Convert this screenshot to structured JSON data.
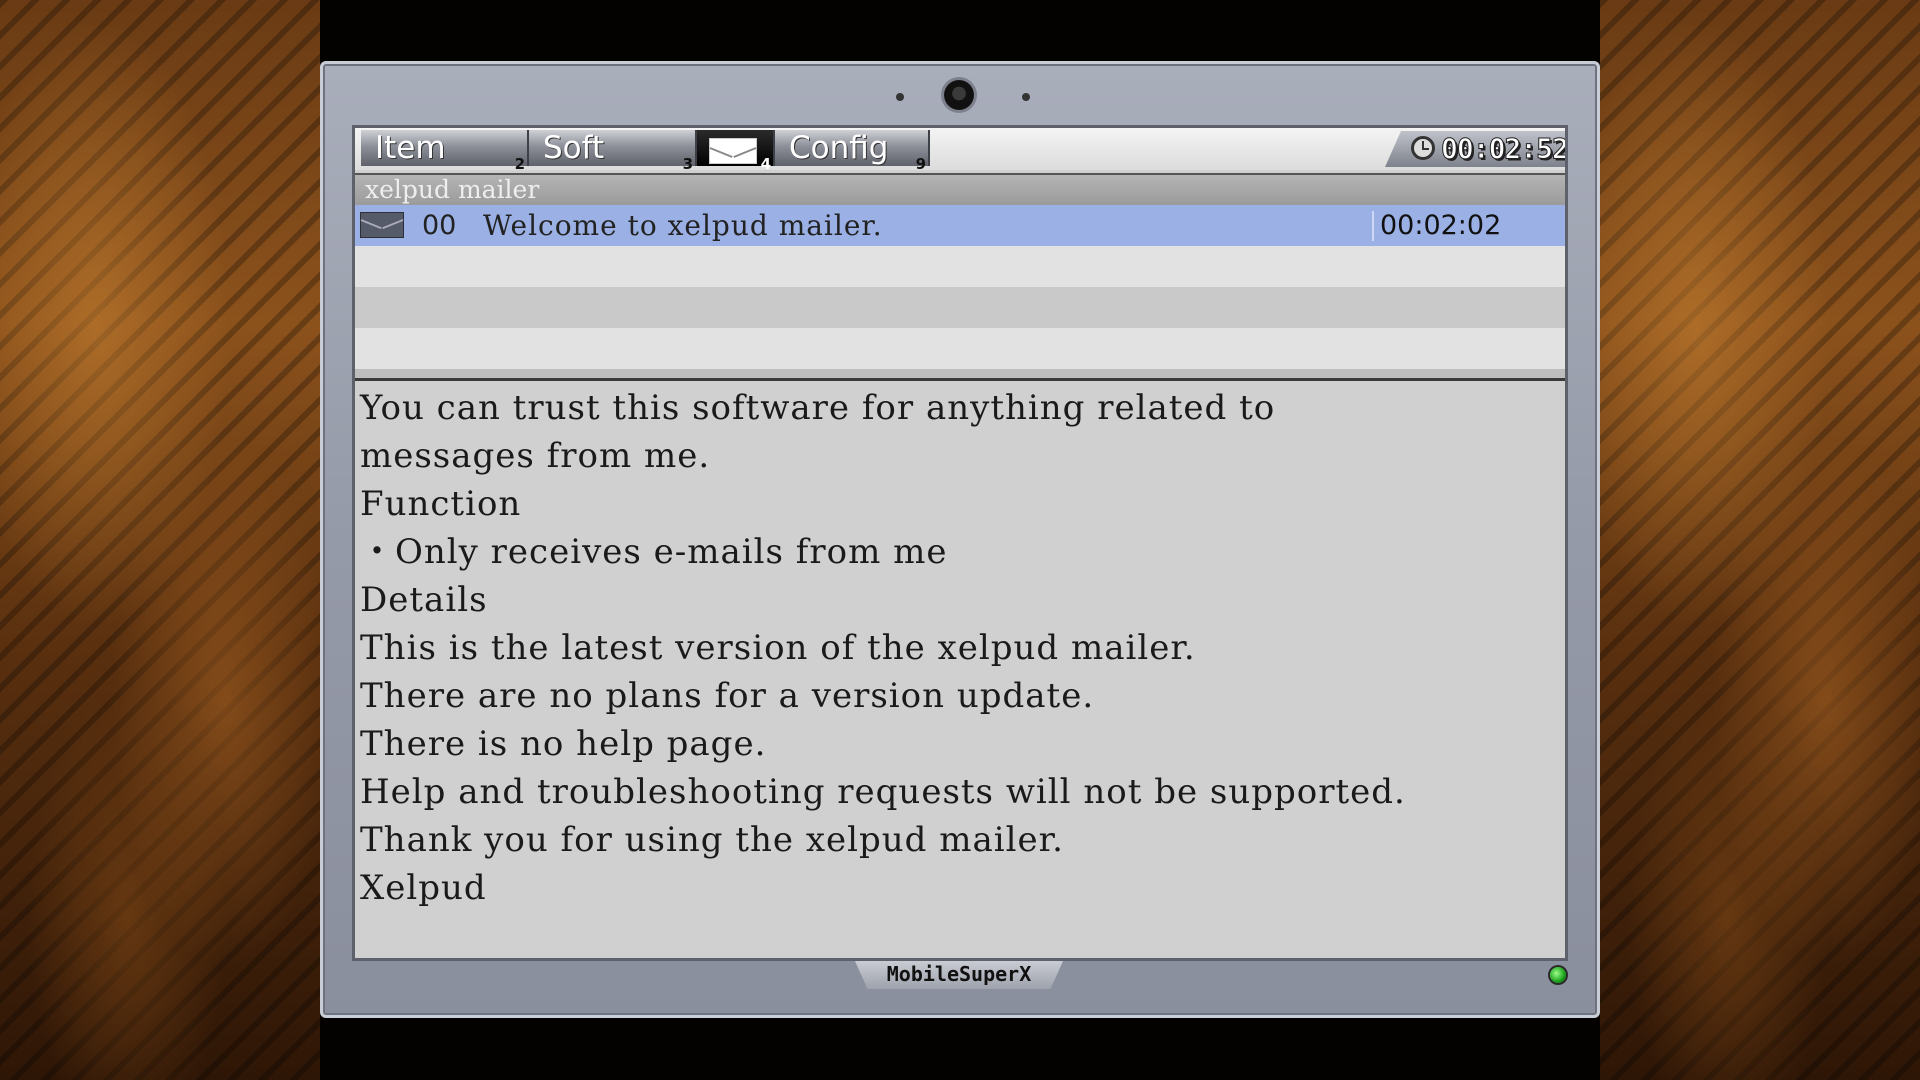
{
  "tabs": [
    {
      "label": "Item",
      "num": "2"
    },
    {
      "label": "Soft",
      "num": "3"
    },
    {
      "label": "",
      "num": "4"
    },
    {
      "label": "Config",
      "num": "9"
    }
  ],
  "clock": "00:02:52",
  "window_title": "xelpud mailer",
  "messages": [
    {
      "num": "00",
      "subject": "Welcome to xelpud mailer.",
      "time": "00:02:02"
    }
  ],
  "body_lines": [
    "You can trust this software for anything related to",
    "messages from me.",
    "Function",
    "・Only receives e-mails from me",
    "Details",
    "This is the latest version of the xelpud mailer.",
    "There are no plans for a version update.",
    "There is no help page.",
    "Help and troubleshooting requests will not be supported.",
    "Thank you for using the xelpud mailer.",
    "Xelpud"
  ],
  "brand": "MobileSuperX",
  "colors": {
    "selected_row": "#9bb0e4",
    "screen_bg": "#d0d0d0",
    "status_led": "#1aa01a"
  },
  "icons": [
    "clock-icon",
    "mail-icon",
    "envelope-icon",
    "camera-icon",
    "status-led-icon"
  ]
}
